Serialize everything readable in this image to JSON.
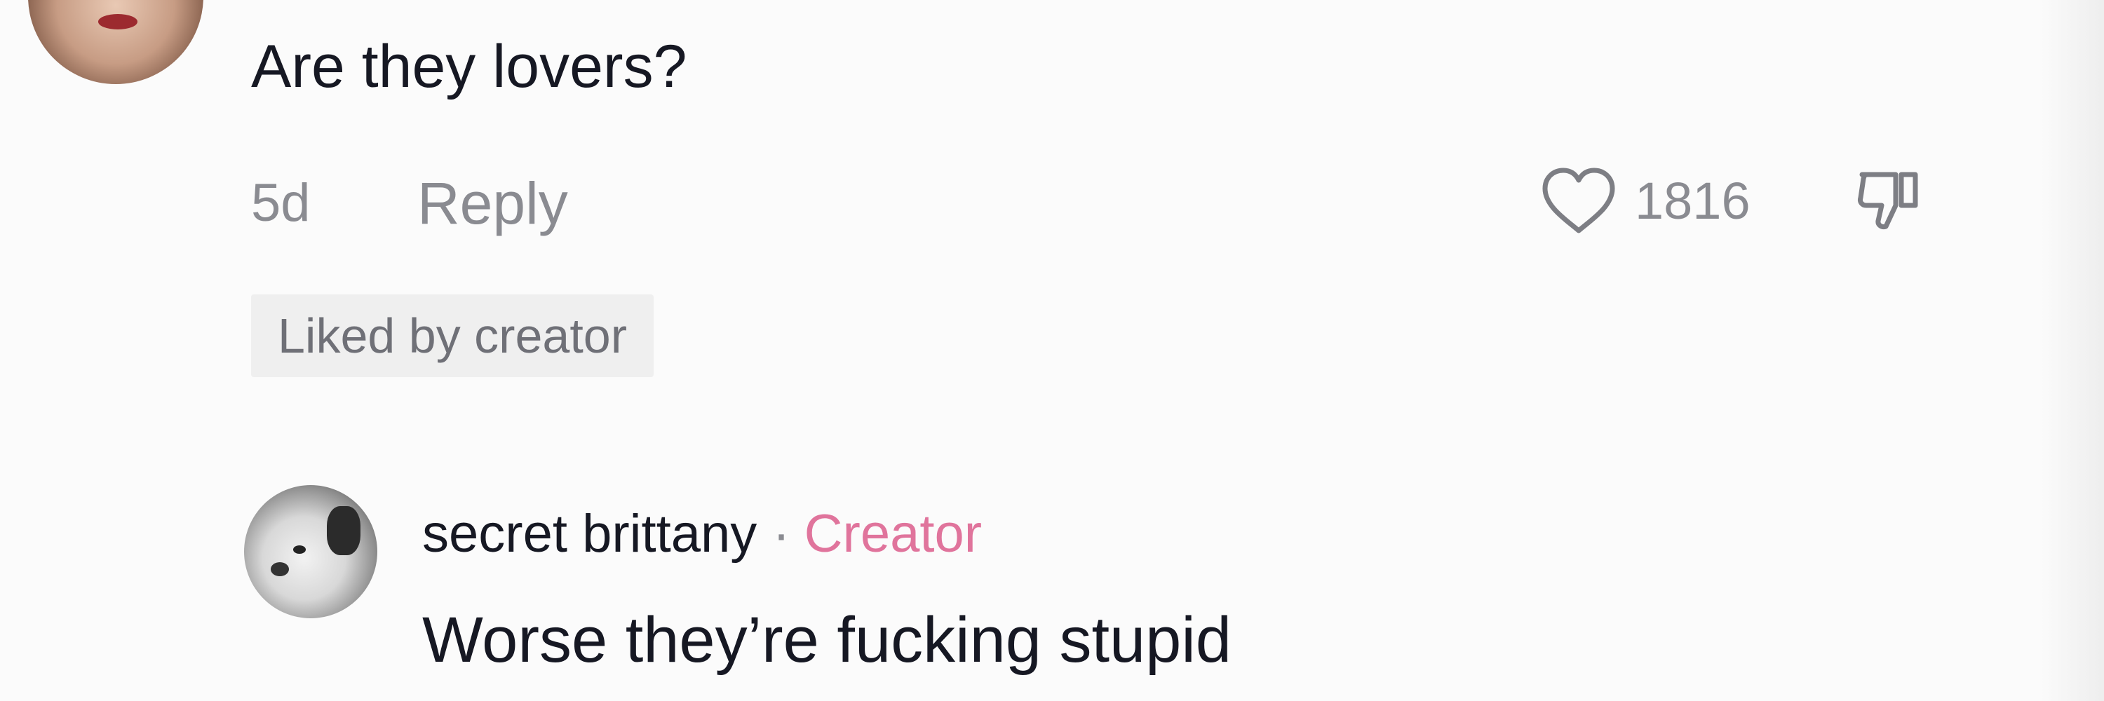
{
  "comment": {
    "text": "Are they lovers?",
    "time": "5d",
    "reply_label": "Reply",
    "like_count": "1816",
    "liked_badge": "Liked by creator"
  },
  "reply": {
    "username": "secret brittany",
    "separator": "·",
    "creator_badge": "Creator",
    "text": "Worse they’re fucking stupid"
  },
  "icons": {
    "like": "heart-outline-icon",
    "dislike": "thumbs-down-icon"
  },
  "colors": {
    "text_primary": "#161823",
    "text_secondary": "#8a8b91",
    "creator_pink": "#e0749c",
    "badge_bg": "#efefef"
  }
}
